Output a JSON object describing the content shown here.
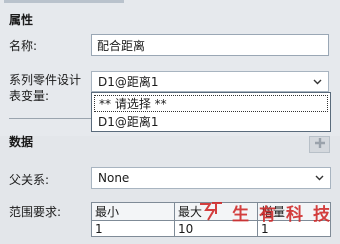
{
  "properties": {
    "section_title": "属性",
    "name_label": "名称:",
    "name_value": "配合距离",
    "config_var_label_line1": "系列零件设计",
    "config_var_label_line2": "表变量:",
    "config_var_selected": "D1@距离1",
    "dropdown_options": [
      "** 请选择 **",
      "D1@距离1"
    ]
  },
  "data_section": {
    "section_title": "数据",
    "parent_label": "父关系:",
    "parent_value": "None",
    "range_label": "范围要求:",
    "range_headers": [
      "最小",
      "最大",
      "增量"
    ],
    "range_values": [
      "1",
      "10",
      "1"
    ]
  },
  "watermark": {
    "text": [
      "生",
      "有",
      "科",
      "技"
    ]
  },
  "colors": {
    "panel": "#e6e9ed",
    "watermark": "#d02b2b"
  }
}
